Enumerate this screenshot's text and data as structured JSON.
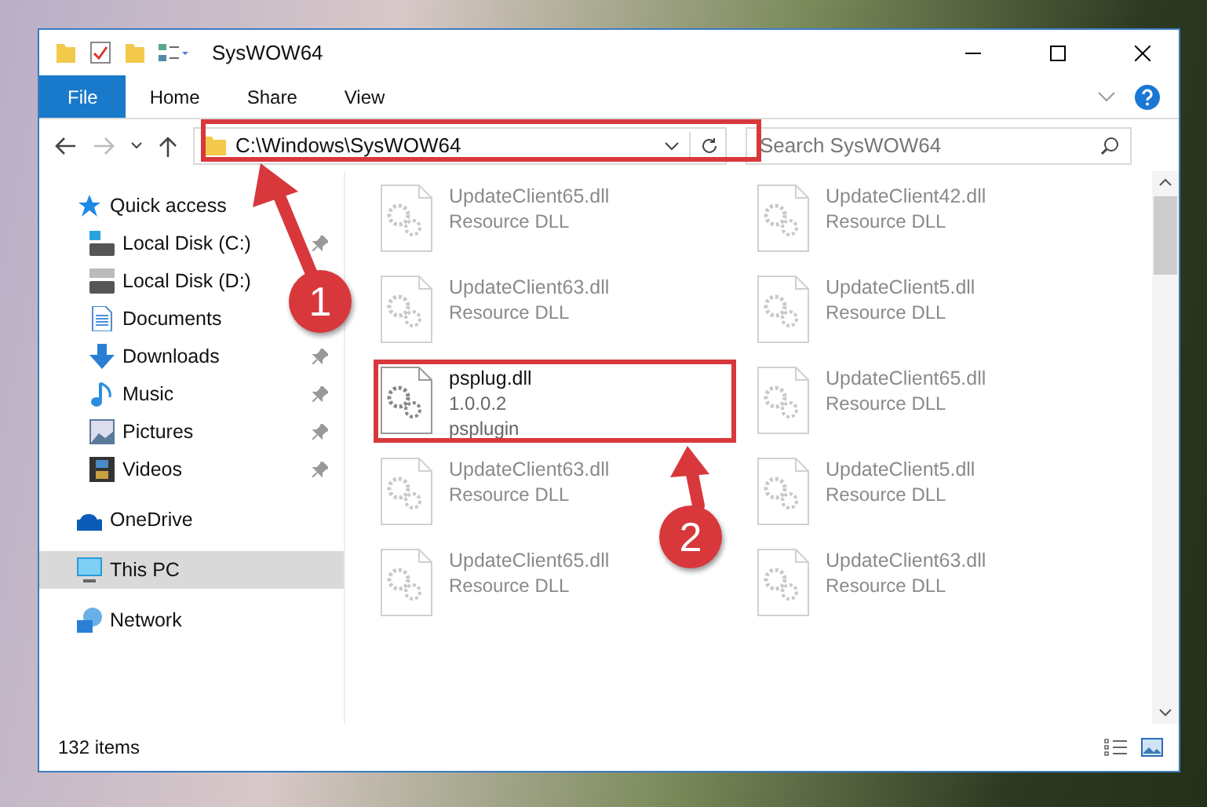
{
  "window": {
    "title": "SysWOW64"
  },
  "ribbon_tabs": [
    {
      "label": "File",
      "selected": true
    },
    {
      "label": "Home",
      "selected": false
    },
    {
      "label": "Share",
      "selected": false
    },
    {
      "label": "View",
      "selected": false
    }
  ],
  "address_bar": {
    "value": "C:\\Windows\\SysWOW64"
  },
  "search": {
    "placeholder": "Search SysWOW64"
  },
  "navigation": [
    {
      "label": "Quick access",
      "kind": "star",
      "selected": false,
      "pinned": false,
      "children": [
        {
          "label": "Local Disk (C:)",
          "kind": "system-drive",
          "selected": false,
          "pinned": true
        },
        {
          "label": "Local Disk (D:)",
          "kind": "drive",
          "selected": false,
          "pinned": false
        },
        {
          "label": "Documents",
          "kind": "documents",
          "selected": false,
          "pinned": false
        },
        {
          "label": "Downloads",
          "kind": "downloads",
          "selected": false,
          "pinned": true
        },
        {
          "label": "Music",
          "kind": "music",
          "selected": false,
          "pinned": true
        },
        {
          "label": "Pictures",
          "kind": "pictures",
          "selected": false,
          "pinned": true
        },
        {
          "label": "Videos",
          "kind": "videos",
          "selected": false,
          "pinned": true
        }
      ]
    },
    {
      "label": "OneDrive",
      "kind": "cloud",
      "selected": false,
      "pinned": false
    },
    {
      "label": "This PC",
      "kind": "pc",
      "selected": true,
      "pinned": false
    },
    {
      "label": "Network",
      "kind": "network",
      "selected": false,
      "pinned": false
    }
  ],
  "files": [
    {
      "name": "UpdateClient65.dll",
      "lines": [
        "Resource DLL"
      ],
      "faded": true
    },
    {
      "name": "UpdateClient42.dll",
      "lines": [
        "Resource DLL"
      ],
      "faded": true
    },
    {
      "name": "UpdateClient63.dll",
      "lines": [
        "Resource DLL"
      ],
      "faded": true
    },
    {
      "name": "UpdateClient5.dll",
      "lines": [
        "Resource DLL"
      ],
      "faded": true
    },
    {
      "name": "psplug.dll",
      "lines": [
        "1.0.0.2",
        "psplugin"
      ],
      "faded": false
    },
    {
      "name": "UpdateClient65.dll",
      "lines": [
        "Resource DLL"
      ],
      "faded": true
    },
    {
      "name": "UpdateClient63.dll",
      "lines": [
        "Resource DLL"
      ],
      "faded": true
    },
    {
      "name": "UpdateClient5.dll",
      "lines": [
        "Resource DLL"
      ],
      "faded": true
    },
    {
      "name": "UpdateClient65.dll",
      "lines": [
        "Resource DLL"
      ],
      "faded": true
    },
    {
      "name": "UpdateClient63.dll",
      "lines": [
        "Resource DLL"
      ],
      "faded": true
    }
  ],
  "status_bar": {
    "count": "132 items"
  },
  "annotations": [
    {
      "number": "1"
    },
    {
      "number": "2"
    }
  ]
}
